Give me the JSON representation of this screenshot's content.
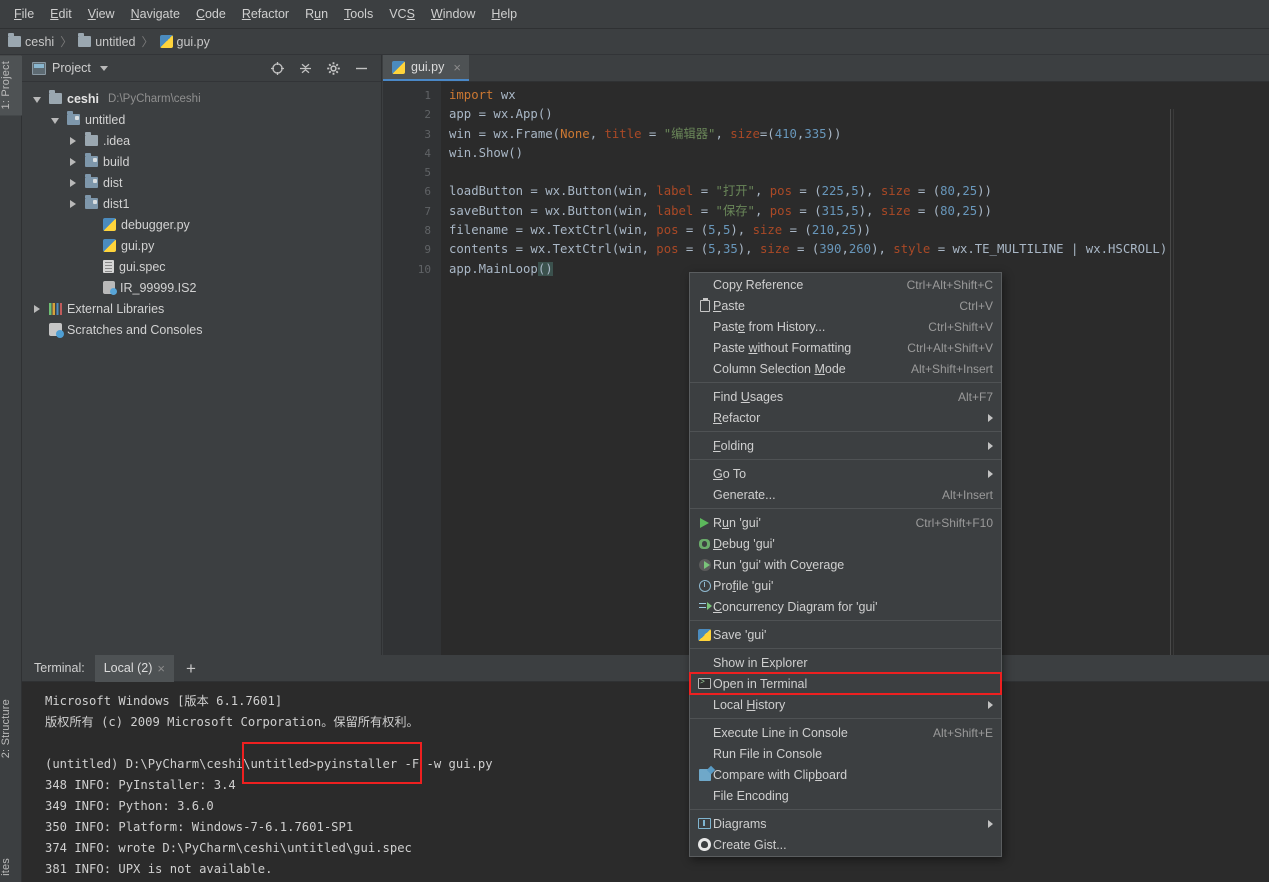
{
  "menubar": {
    "items": [
      {
        "label": "File",
        "mnemonic": "F"
      },
      {
        "label": "Edit",
        "mnemonic": "E"
      },
      {
        "label": "View",
        "mnemonic": "V"
      },
      {
        "label": "Navigate",
        "mnemonic": "N"
      },
      {
        "label": "Code",
        "mnemonic": "C"
      },
      {
        "label": "Refactor",
        "mnemonic": "R"
      },
      {
        "label": "Run",
        "mnemonic": "u"
      },
      {
        "label": "Tools",
        "mnemonic": "T"
      },
      {
        "label": "VCS",
        "mnemonic": "S"
      },
      {
        "label": "Window",
        "mnemonic": "W"
      },
      {
        "label": "Help",
        "mnemonic": "H"
      }
    ]
  },
  "breadcrumb": {
    "items": [
      {
        "label": "ceshi",
        "icon": "folder-icon"
      },
      {
        "label": "untitled",
        "icon": "folder-icon"
      },
      {
        "label": "gui.py",
        "icon": "python-file-icon"
      }
    ],
    "separator": "〉"
  },
  "left_rail": {
    "top_tab": {
      "label": "1: Project",
      "mnemonic": "1",
      "selected": true
    },
    "bottom_tabs": [
      {
        "label": "2: Structure",
        "mnemonic": "2"
      },
      {
        "label": "ites"
      }
    ]
  },
  "project_panel": {
    "title": "Project",
    "tools": [
      "locate-icon",
      "collapse-all-icon",
      "gear-icon",
      "minimize-icon"
    ],
    "tree": [
      {
        "indent": 0,
        "twisty": "down",
        "icon": "folder-icon",
        "label": "ceshi",
        "bold": true,
        "sub": "D:\\PyCharm\\ceshi"
      },
      {
        "indent": 1,
        "twisty": "down",
        "icon": "folder-mod-icon",
        "label": "untitled",
        "bold": false,
        "sub": ""
      },
      {
        "indent": 2,
        "twisty": "right",
        "icon": "folder-icon",
        "label": ".idea",
        "bold": false,
        "sub": ""
      },
      {
        "indent": 2,
        "twisty": "right",
        "icon": "folder-mod-icon",
        "label": "build",
        "bold": false,
        "sub": ""
      },
      {
        "indent": 2,
        "twisty": "right",
        "icon": "folder-mod-icon",
        "label": "dist",
        "bold": false,
        "sub": ""
      },
      {
        "indent": 2,
        "twisty": "right",
        "icon": "folder-mod-icon",
        "label": "dist1",
        "bold": false,
        "sub": ""
      },
      {
        "indent": 3,
        "twisty": "none",
        "icon": "python-file-icon",
        "label": "debugger.py",
        "bold": false,
        "sub": ""
      },
      {
        "indent": 3,
        "twisty": "none",
        "icon": "python-file-icon",
        "label": "gui.py",
        "bold": false,
        "sub": ""
      },
      {
        "indent": 3,
        "twisty": "none",
        "icon": "spec-file-icon",
        "label": "gui.spec",
        "bold": false,
        "sub": ""
      },
      {
        "indent": 3,
        "twisty": "none",
        "icon": "is2-file-icon",
        "label": "IR_99999.IS2",
        "bold": false,
        "sub": ""
      },
      {
        "indent": 0,
        "twisty": "right",
        "icon": "libraries-icon",
        "label": "External Libraries",
        "bold": false,
        "sub": ""
      },
      {
        "indent": 0,
        "twisty": "none",
        "icon": "scratches-icon",
        "label": "Scratches and Consoles",
        "bold": false,
        "sub": ""
      }
    ]
  },
  "editor": {
    "tab": {
      "label": "gui.py",
      "icon": "python-file-icon",
      "close": "×",
      "active": true
    },
    "line_numbers": [
      "1",
      "2",
      "3",
      "4",
      "5",
      "6",
      "7",
      "8",
      "9",
      "10"
    ],
    "code_lines": [
      "import wx",
      "app = wx.App()",
      "win = wx.Frame(None, title = \"编辑器\", size=(410,335))",
      "win.Show()",
      "",
      "loadButton = wx.Button(win, label = \"打开\", pos = (225,5), size = (80,25))",
      "saveButton = wx.Button(win, label = \"保存\", pos = (315,5), size = (80,25))",
      "filename = wx.TextCtrl(win, pos = (5,5), size = (210,25))",
      "contents = wx.TextCtrl(win, pos = (5,35), size = (390,260), style = wx.TE_MULTILINE | wx.HSCROLL)",
      "app.MainLoop()"
    ]
  },
  "context_menu": {
    "groups": [
      {
        "items": [
          {
            "icon": "",
            "label": "Copy Reference",
            "mnemonic": "y",
            "shortcut": "Ctrl+Alt+Shift+C",
            "submenu": false
          },
          {
            "icon": "paste-icon",
            "label": "Paste",
            "mnemonic": "P",
            "shortcut": "Ctrl+V",
            "submenu": false
          },
          {
            "icon": "",
            "label": "Paste from History...",
            "mnemonic": "e",
            "shortcut": "Ctrl+Shift+V",
            "submenu": false
          },
          {
            "icon": "",
            "label": "Paste without Formatting",
            "mnemonic": "w",
            "shortcut": "Ctrl+Alt+Shift+V",
            "submenu": false
          },
          {
            "icon": "",
            "label": "Column Selection Mode",
            "mnemonic": "M",
            "shortcut": "Alt+Shift+Insert",
            "submenu": false
          }
        ]
      },
      {
        "items": [
          {
            "icon": "",
            "label": "Find Usages",
            "mnemonic": "U",
            "shortcut": "Alt+F7",
            "submenu": false
          },
          {
            "icon": "",
            "label": "Refactor",
            "mnemonic": "R",
            "shortcut": "",
            "submenu": true
          }
        ]
      },
      {
        "items": [
          {
            "icon": "",
            "label": "Folding",
            "mnemonic": "F",
            "shortcut": "",
            "submenu": true
          }
        ]
      },
      {
        "items": [
          {
            "icon": "",
            "label": "Go To",
            "mnemonic": "G",
            "shortcut": "",
            "submenu": true
          },
          {
            "icon": "",
            "label": "Generate...",
            "mnemonic": "",
            "shortcut": "Alt+Insert",
            "submenu": false
          }
        ]
      },
      {
        "items": [
          {
            "icon": "run-icon",
            "label": "Run 'gui'",
            "mnemonic": "u",
            "shortcut": "Ctrl+Shift+F10",
            "submenu": false
          },
          {
            "icon": "debug-icon",
            "label": "Debug 'gui'",
            "mnemonic": "D",
            "shortcut": "",
            "submenu": false
          },
          {
            "icon": "coverage-icon",
            "label": "Run 'gui' with Coverage",
            "mnemonic": "v",
            "shortcut": "",
            "submenu": false
          },
          {
            "icon": "profile-icon",
            "label": "Profile 'gui'",
            "mnemonic": "f",
            "shortcut": "",
            "submenu": false
          },
          {
            "icon": "concurrency-icon",
            "label": "Concurrency Diagram for 'gui'",
            "mnemonic": "C",
            "shortcut": "",
            "submenu": false
          }
        ]
      },
      {
        "items": [
          {
            "icon": "save-python-icon",
            "label": "Save 'gui'",
            "mnemonic": "",
            "shortcut": "",
            "submenu": false
          }
        ]
      },
      {
        "items": [
          {
            "icon": "",
            "label": "Show in Explorer",
            "mnemonic": "",
            "shortcut": "",
            "submenu": false
          },
          {
            "icon": "terminal-icon",
            "label": "Open in Terminal",
            "mnemonic": "",
            "shortcut": "",
            "submenu": false,
            "highlighted": true
          },
          {
            "icon": "",
            "label": "Local History",
            "mnemonic": "H",
            "shortcut": "",
            "submenu": true
          }
        ]
      },
      {
        "items": [
          {
            "icon": "",
            "label": "Execute Line in Console",
            "mnemonic": "",
            "shortcut": "Alt+Shift+E",
            "submenu": false
          },
          {
            "icon": "",
            "label": "Run File in Console",
            "mnemonic": "",
            "shortcut": "",
            "submenu": false
          },
          {
            "icon": "compare-icon",
            "label": "Compare with Clipboard",
            "mnemonic": "b",
            "shortcut": "",
            "submenu": false
          },
          {
            "icon": "",
            "label": "File Encoding",
            "mnemonic": "",
            "shortcut": "",
            "submenu": false
          }
        ]
      },
      {
        "items": [
          {
            "icon": "diagrams-icon",
            "label": "Diagrams",
            "mnemonic": "",
            "shortcut": "",
            "submenu": true
          },
          {
            "icon": "gist-icon",
            "label": "Create Gist...",
            "mnemonic": "",
            "shortcut": "",
            "submenu": false
          }
        ]
      }
    ]
  },
  "terminal": {
    "title": "Terminal:",
    "tab": {
      "label": "Local (2)",
      "close": "×"
    },
    "add_button": "+",
    "lines": [
      "Microsoft Windows [版本 6.1.7601]",
      "版权所有 (c) 2009 Microsoft Corporation。保留所有权利。",
      "",
      "(untitled) D:\\PyCharm\\ceshi\\untitled>pyinstaller -F -w gui.py",
      "348 INFO: PyInstaller: 3.4",
      "349 INFO: Python: 3.6.0",
      "350 INFO: Platform: Windows-7-6.1.7601-SP1",
      "374 INFO: wrote D:\\PyCharm\\ceshi\\untitled\\gui.spec",
      "381 INFO: UPX is not available."
    ],
    "highlighted_command": "pyinstaller -F -w gui.py"
  },
  "colors": {
    "panel_bg": "#3c3f41",
    "editor_bg": "#2b2b2b",
    "gutter_bg": "#313335",
    "selected_tab": "#4e5254",
    "tab_underline": "#4a88c7",
    "highlight_red": "#ee2020",
    "text": "#bbbbbb",
    "keyword_orange": "#cc7832",
    "string_green": "#6a8759",
    "number_blue": "#6897bb",
    "attr_red": "#aa4926"
  }
}
